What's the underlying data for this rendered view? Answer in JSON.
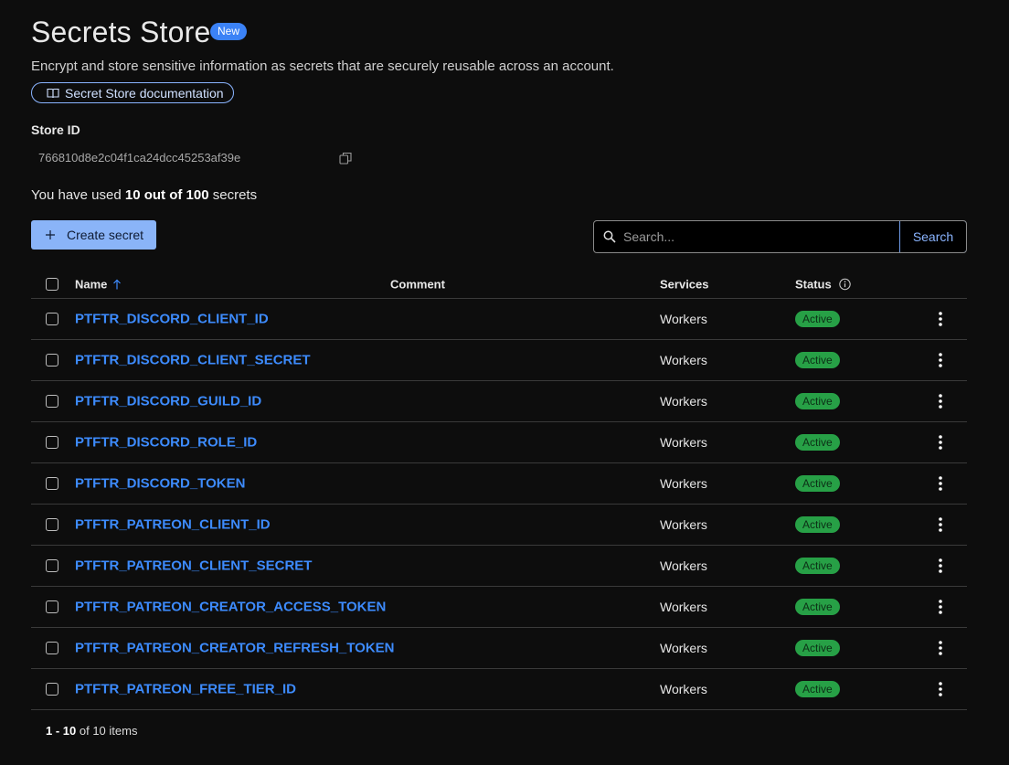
{
  "page": {
    "title": "Secrets Store",
    "new_badge": "New",
    "subtitle": "Encrypt and store sensitive information as secrets that are securely reusable across an account.",
    "doc_link": "Secret Store documentation"
  },
  "store": {
    "label": "Store ID",
    "id": "766810d8e2c04f1ca24dcc45253af39e"
  },
  "usage": {
    "prefix": "You have used",
    "amount": "10 out of 100",
    "suffix": "secrets"
  },
  "toolbar": {
    "create_label": "Create secret",
    "search_placeholder": "Search...",
    "search_button": "Search"
  },
  "table": {
    "headers": {
      "name": "Name",
      "comment": "Comment",
      "services": "Services",
      "status": "Status"
    },
    "rows": [
      {
        "name": "PTFTR_DISCORD_CLIENT_ID",
        "comment": "",
        "services": "Workers",
        "status": "Active"
      },
      {
        "name": "PTFTR_DISCORD_CLIENT_SECRET",
        "comment": "",
        "services": "Workers",
        "status": "Active"
      },
      {
        "name": "PTFTR_DISCORD_GUILD_ID",
        "comment": "",
        "services": "Workers",
        "status": "Active"
      },
      {
        "name": "PTFTR_DISCORD_ROLE_ID",
        "comment": "",
        "services": "Workers",
        "status": "Active"
      },
      {
        "name": "PTFTR_DISCORD_TOKEN",
        "comment": "",
        "services": "Workers",
        "status": "Active"
      },
      {
        "name": "PTFTR_PATREON_CLIENT_ID",
        "comment": "",
        "services": "Workers",
        "status": "Active"
      },
      {
        "name": "PTFTR_PATREON_CLIENT_SECRET",
        "comment": "",
        "services": "Workers",
        "status": "Active"
      },
      {
        "name": "PTFTR_PATREON_CREATOR_ACCESS_TOKEN",
        "comment": "",
        "services": "Workers",
        "status": "Active"
      },
      {
        "name": "PTFTR_PATREON_CREATOR_REFRESH_TOKEN",
        "comment": "",
        "services": "Workers",
        "status": "Active"
      },
      {
        "name": "PTFTR_PATREON_FREE_TIER_ID",
        "comment": "",
        "services": "Workers",
        "status": "Active"
      }
    ]
  },
  "pagination": {
    "range": "1 - 10",
    "suffix": "of 10 items"
  },
  "icons": {
    "doc": "book-icon",
    "copy": "copy-icon",
    "plus": "plus-icon",
    "search": "search-icon",
    "sort": "arrow-up-icon",
    "info": "info-icon",
    "menu": "kebab-menu-icon"
  },
  "colors": {
    "background": "#0d0d0d",
    "accent": "#3d8bfd",
    "primary_button": "#8ab4f8",
    "status_active": "#27a046",
    "new_badge": "#3b82f6"
  }
}
